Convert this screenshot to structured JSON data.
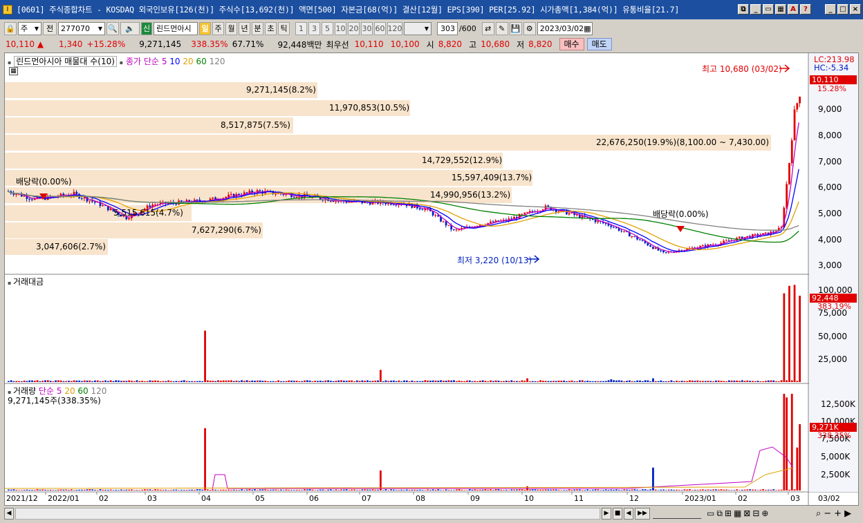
{
  "window": {
    "app_icon": "I",
    "title": "[0601] 주식종합차트 - KOSDAQ 외국인보유[126(천)] 주식수[13,692(천)] 액면[500] 자본금[68(억)] 결산[12월] EPS[390] PER[25.92] 시가총액[1,384(억)] 유통비율[21.7]"
  },
  "toolbar": {
    "period_select": "주",
    "prefix": "전",
    "code": "277070",
    "shin_label": "신",
    "name": "린드먼아시",
    "periods": [
      "일",
      "주",
      "월",
      "년",
      "분",
      "초",
      "틱"
    ],
    "selected_period": "일",
    "intervals": [
      "1",
      "3",
      "5",
      "10",
      "20",
      "30",
      "60",
      "120"
    ],
    "count": "303",
    "count_total": "/600",
    "date": "2023/03/02"
  },
  "quote": {
    "price": "10,110",
    "change": "1,340",
    "change_pct": "+15.28%",
    "volume": "9,271,145",
    "volume_ratio": "338.35%",
    "turnover": "67.71%",
    "amount": "92,448백만",
    "best_ask_label": "최우선",
    "ask": "10,110",
    "bid": "10,100",
    "open_label": "시",
    "open": "8,820",
    "high_label": "고",
    "high": "10,680",
    "low_label": "저",
    "low": "8,820",
    "buy_label": "매수",
    "sell_label": "매도"
  },
  "price_pane": {
    "legend_main": "린드먼아시아 매물대 수(10)",
    "legend_ma_label": "종가 단순",
    "ma_periods": [
      "5",
      "10",
      "20",
      "60",
      "120"
    ],
    "lc": "LC:213.98",
    "hc": "HC:-5.34",
    "high_note": "최고 10,680 (03/02)",
    "low_note": "최저 3,220 (10/13)",
    "dividend_note1": "배당락(0.00%)",
    "dividend_note2": "배당락(0.00%)",
    "current_price": "10,110",
    "current_pct": "15.28%",
    "y_ticks": [
      "9,000",
      "8,000",
      "7,000",
      "6,000",
      "5,000",
      "4,000",
      "3,000"
    ],
    "profile_labels": [
      "9,271,145(8.2%)",
      "11,970,853(10.5%)",
      "8,517,875(7.5%)",
      "22,676,250(19.9%)(8,100.00 ~ 7,430.00)",
      "14,729,552(12.9%)",
      "15,597,409(13.7%)",
      "14,990,956(13.2%)",
      "5,515,615(4.7%)",
      "7,627,290(6.7%)",
      "3,047,606(2.7%)"
    ]
  },
  "amount_pane": {
    "legend": "거래대금",
    "current": "92,448",
    "current_pct": "383.19%",
    "y_ticks": [
      "100,000",
      "75,000",
      "50,000",
      "25,000"
    ]
  },
  "volume_pane": {
    "legend": "거래량",
    "legend_ma_label": "단순",
    "ma_periods": [
      "5",
      "20",
      "60",
      "120"
    ],
    "sub_legend": "9,271,145주(338.35%)",
    "current": "9,271K",
    "current_pct": "338.35%",
    "y_ticks": [
      "12,500K",
      "10,000K",
      "7,500K",
      "5,000K",
      "2,500K"
    ]
  },
  "x_axis": {
    "labels": [
      "2021/12",
      "2022/01",
      "02",
      "03",
      "04",
      "05",
      "06",
      "07",
      "08",
      "09",
      "10",
      "11",
      "12",
      "2023/01",
      "02",
      "03",
      "03/02"
    ]
  },
  "colors": {
    "up": "#e00000",
    "down": "#0020c0",
    "profile": "#f8e4cc",
    "ma5": "#c000c0",
    "ma10": "#0000ff",
    "ma20": "#e0a000",
    "ma60": "#008000",
    "ma120": "#808080"
  }
}
